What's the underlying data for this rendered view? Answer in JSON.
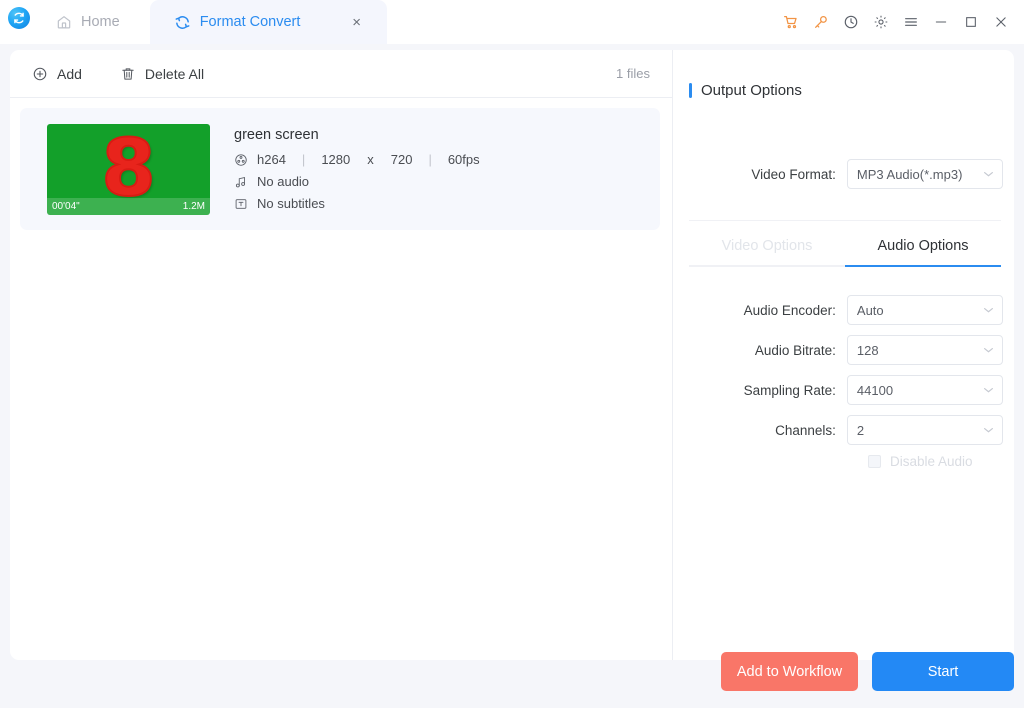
{
  "window": {
    "logo_icon": "app-logo-swirl-icon",
    "controls": [
      {
        "name": "cart-icon",
        "glyph": "cart",
        "color": "#f29445"
      },
      {
        "name": "key-icon",
        "glyph": "key",
        "color": "#f29445"
      },
      {
        "name": "history-clock-icon",
        "glyph": "clock",
        "color": "#5b6069"
      },
      {
        "name": "settings-gear-icon",
        "glyph": "gear",
        "color": "#5b6069"
      },
      {
        "name": "menu-icon",
        "glyph": "hamburger",
        "color": "#5b6069"
      },
      {
        "name": "minimize-icon",
        "glyph": "minimize",
        "color": "#5b6069"
      },
      {
        "name": "maximize-icon",
        "glyph": "maximize",
        "color": "#5b6069"
      },
      {
        "name": "close-icon",
        "glyph": "close",
        "color": "#5b6069"
      }
    ]
  },
  "tabs": [
    {
      "label": "Home",
      "icon": "home-icon",
      "active": false
    },
    {
      "label": "Format Convert",
      "icon": "convert-refresh-icon",
      "active": true,
      "close": "×"
    }
  ],
  "toolbar": {
    "add_label": "Add",
    "add_icon": "plus-circle-icon",
    "delete_all_label": "Delete All",
    "delete_all_icon": "trash-icon",
    "files_count": "1 files"
  },
  "file_list": [
    {
      "title": "green screen",
      "thumbnail": {
        "background_color": "#13a02a",
        "figure": "8",
        "figure_color": "#e8241c",
        "duration": "00'04\"",
        "size": "1.2M"
      },
      "video_icon": "film-reel-icon",
      "codec": "h264",
      "sep1": "|",
      "width": "1280",
      "x": "x",
      "height": "720",
      "sep2": "|",
      "fps": "60fps",
      "audio_icon": "music-note-icon",
      "audio": "No audio",
      "subtitle_icon": "subtitle-text-icon",
      "subtitles": "No subtitles"
    }
  ],
  "output_options": {
    "section_title": "Output Options",
    "accent_color": "#2b8cf0",
    "video_format_label": "Video Format:",
    "video_format_value": "MP3 Audio(*.mp3)",
    "tabs": [
      {
        "label": "Video Options",
        "active": false
      },
      {
        "label": "Audio Options",
        "active": true
      }
    ],
    "fields": [
      {
        "label": "Audio Encoder:",
        "value": "Auto"
      },
      {
        "label": "Audio Bitrate:",
        "value": "128"
      },
      {
        "label": "Sampling Rate:",
        "value": "44100"
      },
      {
        "label": "Channels:",
        "value": "2"
      }
    ],
    "disable_audio_label": "Disable Audio",
    "disable_audio_checked": false
  },
  "actions": {
    "add_to_workflow_label": "Add to Workflow",
    "add_to_workflow_color": "#f97668",
    "start_label": "Start",
    "start_color": "#2389f5"
  }
}
